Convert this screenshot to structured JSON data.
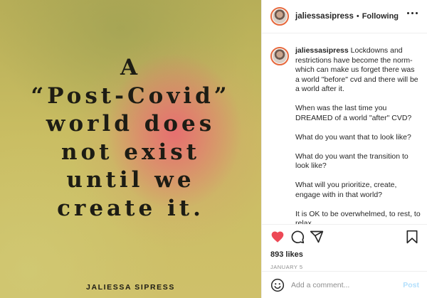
{
  "post": {
    "quote_lines": [
      "A",
      "“Post-Covid”",
      "world does",
      "not exist",
      "until we",
      "create it."
    ],
    "author": "JALIESSA SIPRESS"
  },
  "header": {
    "username": "jaliessasipress",
    "separator": "•",
    "follow_status": "Following"
  },
  "caption": {
    "username": "jaliessasipress",
    "paragraphs": [
      "Lockdowns and restrictions have become the norm- which can make us forget there was a world \"before\" cvd and there will be a world after it.",
      "When was the last time you DREAMED of a world \"after\" CVD?",
      "What do you want that to look like?",
      "What do you want the transition to look like?",
      "What will you prioritize, create, engage with in that world?",
      "It is OK to be overwhelmed, to rest, to relax."
    ]
  },
  "actions": {
    "likes": "893 likes",
    "date": "JANUARY 5"
  },
  "comment": {
    "placeholder": "Add a comment...",
    "post_label": "Post"
  },
  "colors": {
    "heart": "#ed4956",
    "post_button": "#b2dffc",
    "avatar_ring": "#e6683c"
  },
  "icons": [
    "more-icon",
    "heart-icon",
    "comment-icon",
    "share-icon",
    "bookmark-icon",
    "emoji-icon"
  ]
}
